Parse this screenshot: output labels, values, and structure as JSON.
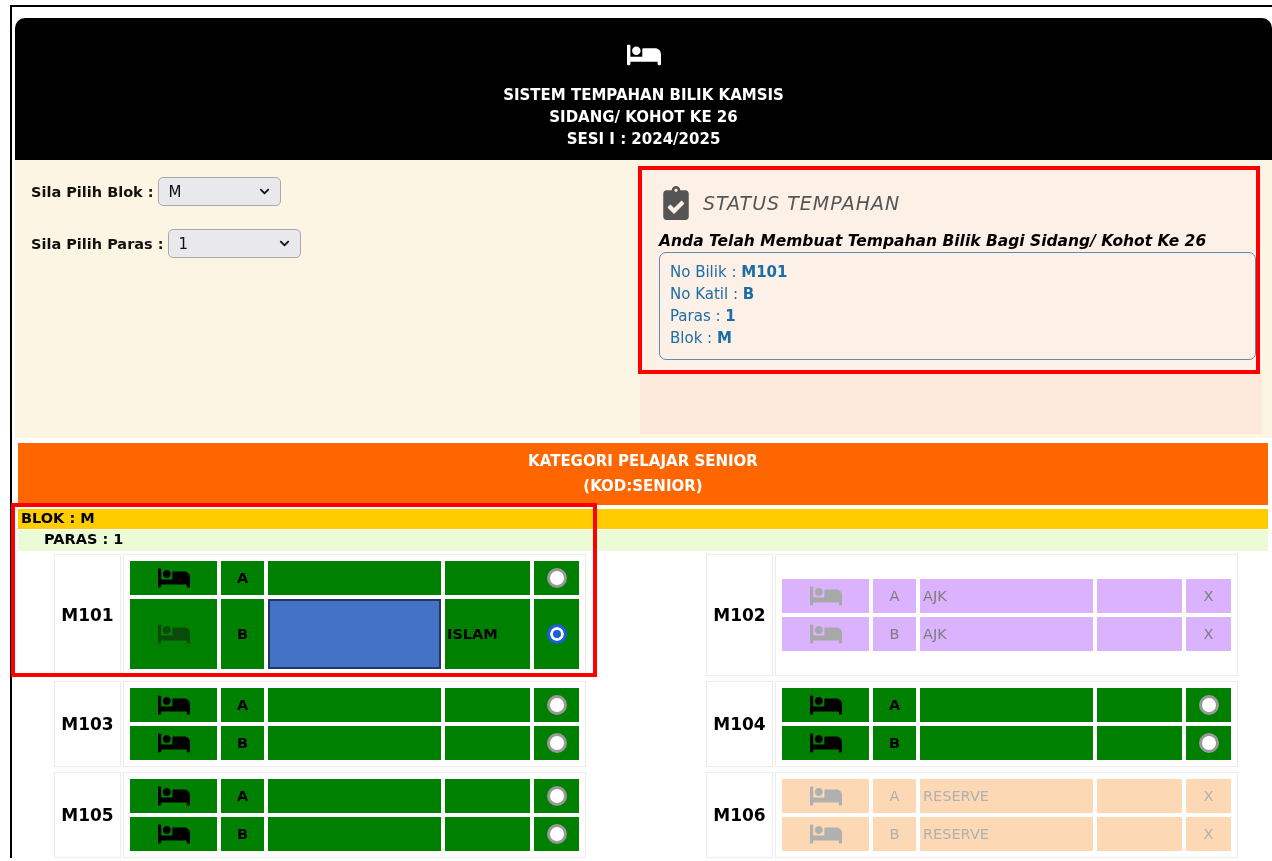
{
  "header": {
    "titles": [
      "SISTEM TEMPAHAN BILIK KAMSIS",
      "SIDANG/ KOHOT KE 26",
      "SESI I : 2024/2025"
    ]
  },
  "filters": [
    {
      "label": "Sila Pilih Blok :",
      "value": "M"
    },
    {
      "label": "Sila Pilih Paras :",
      "value": "1"
    }
  ],
  "status": {
    "title": "STATUS TEMPAHAN",
    "message": "Anda Telah Membuat Tempahan Bilik Bagi Sidang/ Kohot Ke 26",
    "details": [
      "No Bilik : **M101**",
      "No Katil : **B**",
      "Paras : **1**",
      "Blok : **M**"
    ]
  },
  "category": {
    "lines": [
      "KATEGORI PELAJAR SENIOR",
      "(KOD:SENIOR)"
    ]
  },
  "block_label": "BLOK : M",
  "level_label": "PARAS : 1",
  "rooms": [
    {
      "name": "M101",
      "beds": [
        {
          "kind": "available",
          "bed": "A",
          "selected": false
        },
        {
          "kind": "mine",
          "bed": "B",
          "religion": "ISLAM",
          "selected": true
        }
      ]
    },
    {
      "name": "M102",
      "beds": [
        {
          "kind": "ajk",
          "bed": "A",
          "occupant": "AJK",
          "mark": "X"
        },
        {
          "kind": "ajk",
          "bed": "B",
          "occupant": "AJK",
          "mark": "X"
        }
      ]
    },
    {
      "name": "M103",
      "beds": [
        {
          "kind": "available",
          "bed": "A",
          "selected": false
        },
        {
          "kind": "available",
          "bed": "B",
          "selected": false
        }
      ]
    },
    {
      "name": "M104",
      "beds": [
        {
          "kind": "available",
          "bed": "A",
          "selected": false
        },
        {
          "kind": "available",
          "bed": "B",
          "selected": false
        }
      ]
    },
    {
      "name": "M105",
      "beds": [
        {
          "kind": "available",
          "bed": "A",
          "selected": false
        },
        {
          "kind": "available",
          "bed": "B",
          "selected": false
        }
      ]
    },
    {
      "name": "M106",
      "beds": [
        {
          "kind": "reserve",
          "bed": "A",
          "occupant": "RESERVE",
          "mark": "X"
        },
        {
          "kind": "reserve",
          "bed": "B",
          "occupant": "RESERVE",
          "mark": "X"
        }
      ]
    }
  ]
}
